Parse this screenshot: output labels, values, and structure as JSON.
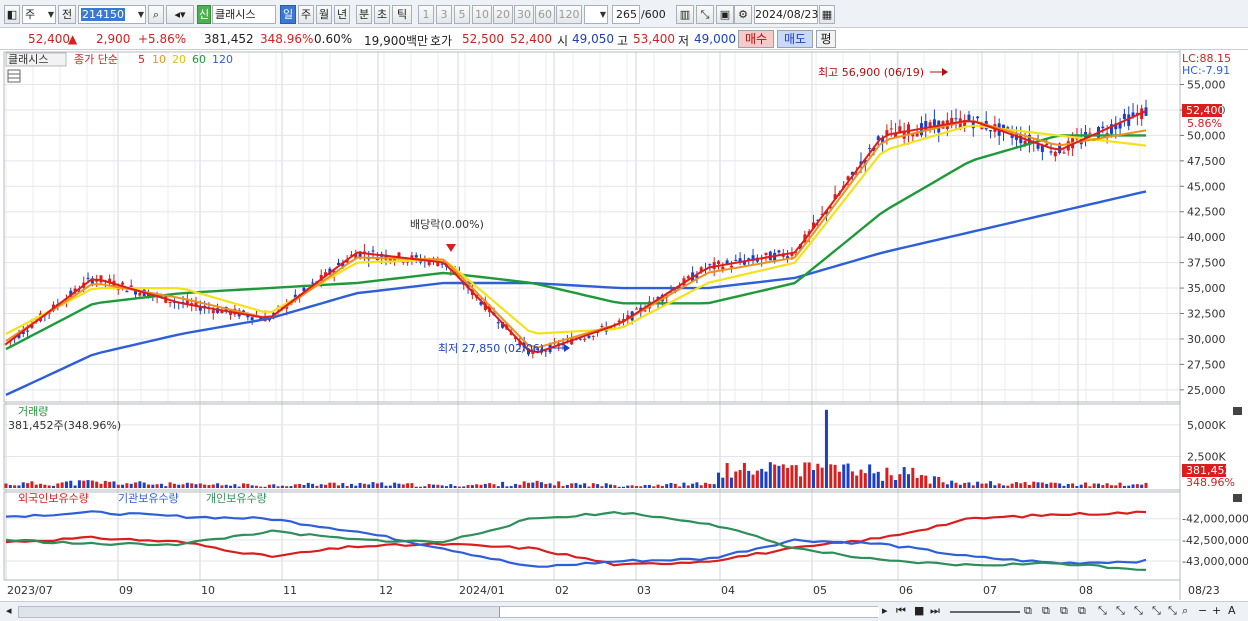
{
  "toolbar": {
    "market_label": "주",
    "prev_label": "전",
    "stock_code": "214150",
    "stock_name": "클래시스",
    "badge": "신",
    "periods": [
      "일",
      "주",
      "월",
      "년",
      "분",
      "초",
      "틱"
    ],
    "intervals": [
      "1",
      "3",
      "5",
      "10",
      "20",
      "30",
      "60",
      "120"
    ],
    "count_display": "265",
    "count_max": "/600",
    "date": "2024/08/23"
  },
  "quote": {
    "price": "52,400",
    "change_arrow": "▲",
    "change": "2,900",
    "change_pct": "+5.86%",
    "volume": "381,452",
    "volume_ratio": "348.96%",
    "turnover": "0.60%",
    "amount": "19,900백만",
    "hoga_label": "호가",
    "hoga1": "52,500",
    "hoga2": "52,400",
    "open_label": "시",
    "open": "49,050",
    "high_label": "고",
    "high": "53,400",
    "low_label": "저",
    "low": "49,000",
    "buy_label": "매수",
    "sell_label": "매도",
    "eval_label": "평"
  },
  "price_panel": {
    "name_label": "클래시스",
    "legend": {
      "close_label": "종가 단순",
      "ma5": "5",
      "ma10": "10",
      "ma20": "20",
      "ma60": "60",
      "ma120": "120"
    },
    "lc_label": "LC:88.15",
    "hc_label": "HC:-7.91",
    "price_tag": "52,400",
    "pct_tag": "5.86%",
    "y_ticks": [
      "55,000",
      "52,500",
      "50,000",
      "47,500",
      "45,000",
      "42,500",
      "40,000",
      "37,500",
      "35,000",
      "32,500",
      "30,000",
      "27,500",
      "25,000"
    ],
    "high_annotation": "최고 56,900 (06/19)",
    "low_annotation": "최저 27,850 (02/06)",
    "dividend_annotation": "배당락(0.00%)"
  },
  "volume_panel": {
    "title": "거래량",
    "subtitle": "381,452주(348.96%)",
    "y_ticks": [
      "5,000K",
      "2,500K"
    ],
    "tag_value": "381,452",
    "tag_pct": "348.96%"
  },
  "holding_panel": {
    "series_labels": [
      "외국인보유수량",
      "기관보유수량",
      "개인보유수량"
    ],
    "y_ticks": [
      "-42,000,000",
      "-42,500,000",
      "-43,000,000"
    ]
  },
  "x_axis": {
    "labels": [
      "2023/07",
      "09",
      "10",
      "11",
      "12",
      "2024/01",
      "02",
      "03",
      "04",
      "05",
      "06",
      "07",
      "08"
    ],
    "right_label": "08/23"
  },
  "colors": {
    "up": "#d81e1e",
    "down": "#1a3fc9",
    "ma5": "#e01b1b",
    "ma10": "#f0901c",
    "ma20": "#f3e21a",
    "ma60": "#1f9a3a",
    "ma120": "#2d5fd8",
    "foreign": "#d81e1e",
    "institution": "#2d5fd8",
    "individual": "#2f8f5a"
  },
  "chart_data": [
    {
      "type": "line",
      "title": "클래시스",
      "x": [
        "2023/07",
        "09",
        "10",
        "11",
        "12",
        "2024/01",
        "02",
        "03",
        "04",
        "05",
        "06",
        "07",
        "08",
        "08/23"
      ],
      "series": [
        {
          "name": "5",
          "values": [
            29500,
            36000,
            33500,
            32000,
            38500,
            37500,
            28500,
            31500,
            37000,
            38500,
            50000,
            51500,
            48500,
            52400
          ]
        },
        {
          "name": "10",
          "values": [
            29800,
            35500,
            34000,
            32000,
            38000,
            37800,
            29000,
            31500,
            36500,
            38000,
            49500,
            51500,
            49000,
            50500
          ]
        },
        {
          "name": "20",
          "values": [
            30500,
            35000,
            35000,
            32500,
            37500,
            37800,
            30500,
            31000,
            35500,
            37500,
            48500,
            51000,
            50000,
            49000
          ]
        },
        {
          "name": "60",
          "values": [
            29000,
            33500,
            34500,
            35000,
            35500,
            36500,
            35500,
            33500,
            33500,
            35500,
            42500,
            47500,
            50000,
            50000
          ]
        },
        {
          "name": "120",
          "values": [
            24500,
            28500,
            30500,
            32000,
            34500,
            35500,
            35500,
            35000,
            35000,
            36000,
            38500,
            40500,
            42500,
            44500
          ]
        }
      ],
      "ylim": [
        24000,
        58000
      ],
      "annotations": {
        "high": "최고 56,900 (06/19)",
        "low": "최저 27,850 (02/06)"
      }
    },
    {
      "type": "bar",
      "title": "거래량",
      "categories": [
        "2023/07",
        "09",
        "10",
        "11",
        "12",
        "2024/01",
        "02",
        "03",
        "04",
        "05",
        "06",
        "07",
        "08",
        "08/23"
      ],
      "values": [
        400,
        600,
        350,
        300,
        450,
        250,
        500,
        300,
        400,
        6200,
        1800,
        500,
        400,
        381.452
      ],
      "ylim": [
        0,
        6500
      ]
    },
    {
      "type": "line",
      "title": "보유수량",
      "x": [
        "2023/07",
        "09",
        "10",
        "11",
        "12",
        "2024/01",
        "02",
        "03",
        "04",
        "05",
        "06",
        "07",
        "08",
        "08/23"
      ],
      "series": [
        {
          "name": "외국인보유수량",
          "values": [
            -42550000,
            -42450000,
            -42550000,
            -42900000,
            -42650000,
            -42600000,
            -42700000,
            -43100000,
            -43000000,
            -42700000,
            -42450000,
            -42000000,
            -41900000,
            -41850000
          ]
        },
        {
          "name": "기관보유수량",
          "values": [
            -41950000,
            -41850000,
            -41950000,
            -42000000,
            -42300000,
            -42700000,
            -43150000,
            -43000000,
            -42950000,
            -42500000,
            -42600000,
            -42900000,
            -43050000,
            -43000000
          ]
        },
        {
          "name": "개인보유수량",
          "values": [
            -42500000,
            -42600000,
            -42600000,
            -42300000,
            -42500000,
            -42550000,
            -42000000,
            -41850000,
            -42100000,
            -42700000,
            -43000000,
            -43100000,
            -43050000,
            -43200000
          ]
        }
      ],
      "ylim": [
        -43400000,
        -41700000
      ]
    }
  ]
}
